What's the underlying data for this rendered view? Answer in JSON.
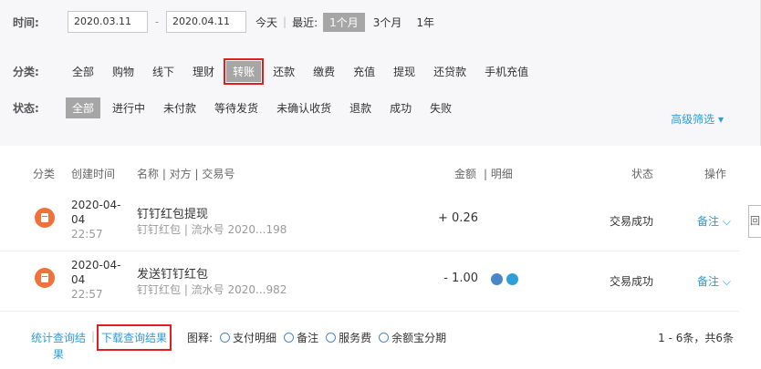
{
  "filter": {
    "time_label": "时间:",
    "date_from": "2020.03.11",
    "date_sep": "-",
    "date_to": "2020.04.11",
    "today": "今天",
    "recent_label": "最近:",
    "ranges": [
      "1个月",
      "3个月",
      "1年"
    ],
    "type_label": "分类:",
    "types": [
      "全部",
      "购物",
      "线下",
      "理财",
      "转账",
      "还款",
      "缴费",
      "充值",
      "提现",
      "还贷款",
      "手机充值"
    ],
    "status_label": "状态:",
    "statuses": [
      "全部",
      "进行中",
      "未付款",
      "等待发货",
      "未确认收货",
      "退款",
      "成功",
      "失败"
    ],
    "advanced": "高级筛选 ▾"
  },
  "table": {
    "headers": {
      "category": "分类",
      "created": "创建时间",
      "name": "名称 | 对方 | 交易号",
      "amount": "金额",
      "detail": "| 明细",
      "status": "状态",
      "action": "操作"
    },
    "rows": [
      {
        "date_line1": "2020-04-",
        "date_line2": "04",
        "time": "22:57",
        "name": "钉钉红包提现",
        "sub": "钉钉红包 | 流水号 2020...198",
        "amount": "+ 0.26",
        "status": "交易成功",
        "action": "备注 ⌵"
      },
      {
        "date_line1": "2020-04-",
        "date_line2": "04",
        "time": "22:57",
        "name": "发送钉钉红包",
        "sub": "钉钉红包 | 流水号 2020...982",
        "amount": "- 1.00",
        "status": "交易成功",
        "action": "备注 ⌵"
      }
    ]
  },
  "side_tab": "回",
  "footer": {
    "stats_link": "统计查询结果",
    "separator": "|",
    "download": "下载查询结果",
    "legend_label": "图释:",
    "legend": [
      "支付明细",
      "备注",
      "服务费",
      "余额宝分期"
    ],
    "pager": "1 - 6条，共6条"
  },
  "colors": {
    "accent": "#2c9cd8",
    "highlight_box": "#e02020",
    "active_chip": "#a6a6a6",
    "category_icon": "#f2703a"
  }
}
